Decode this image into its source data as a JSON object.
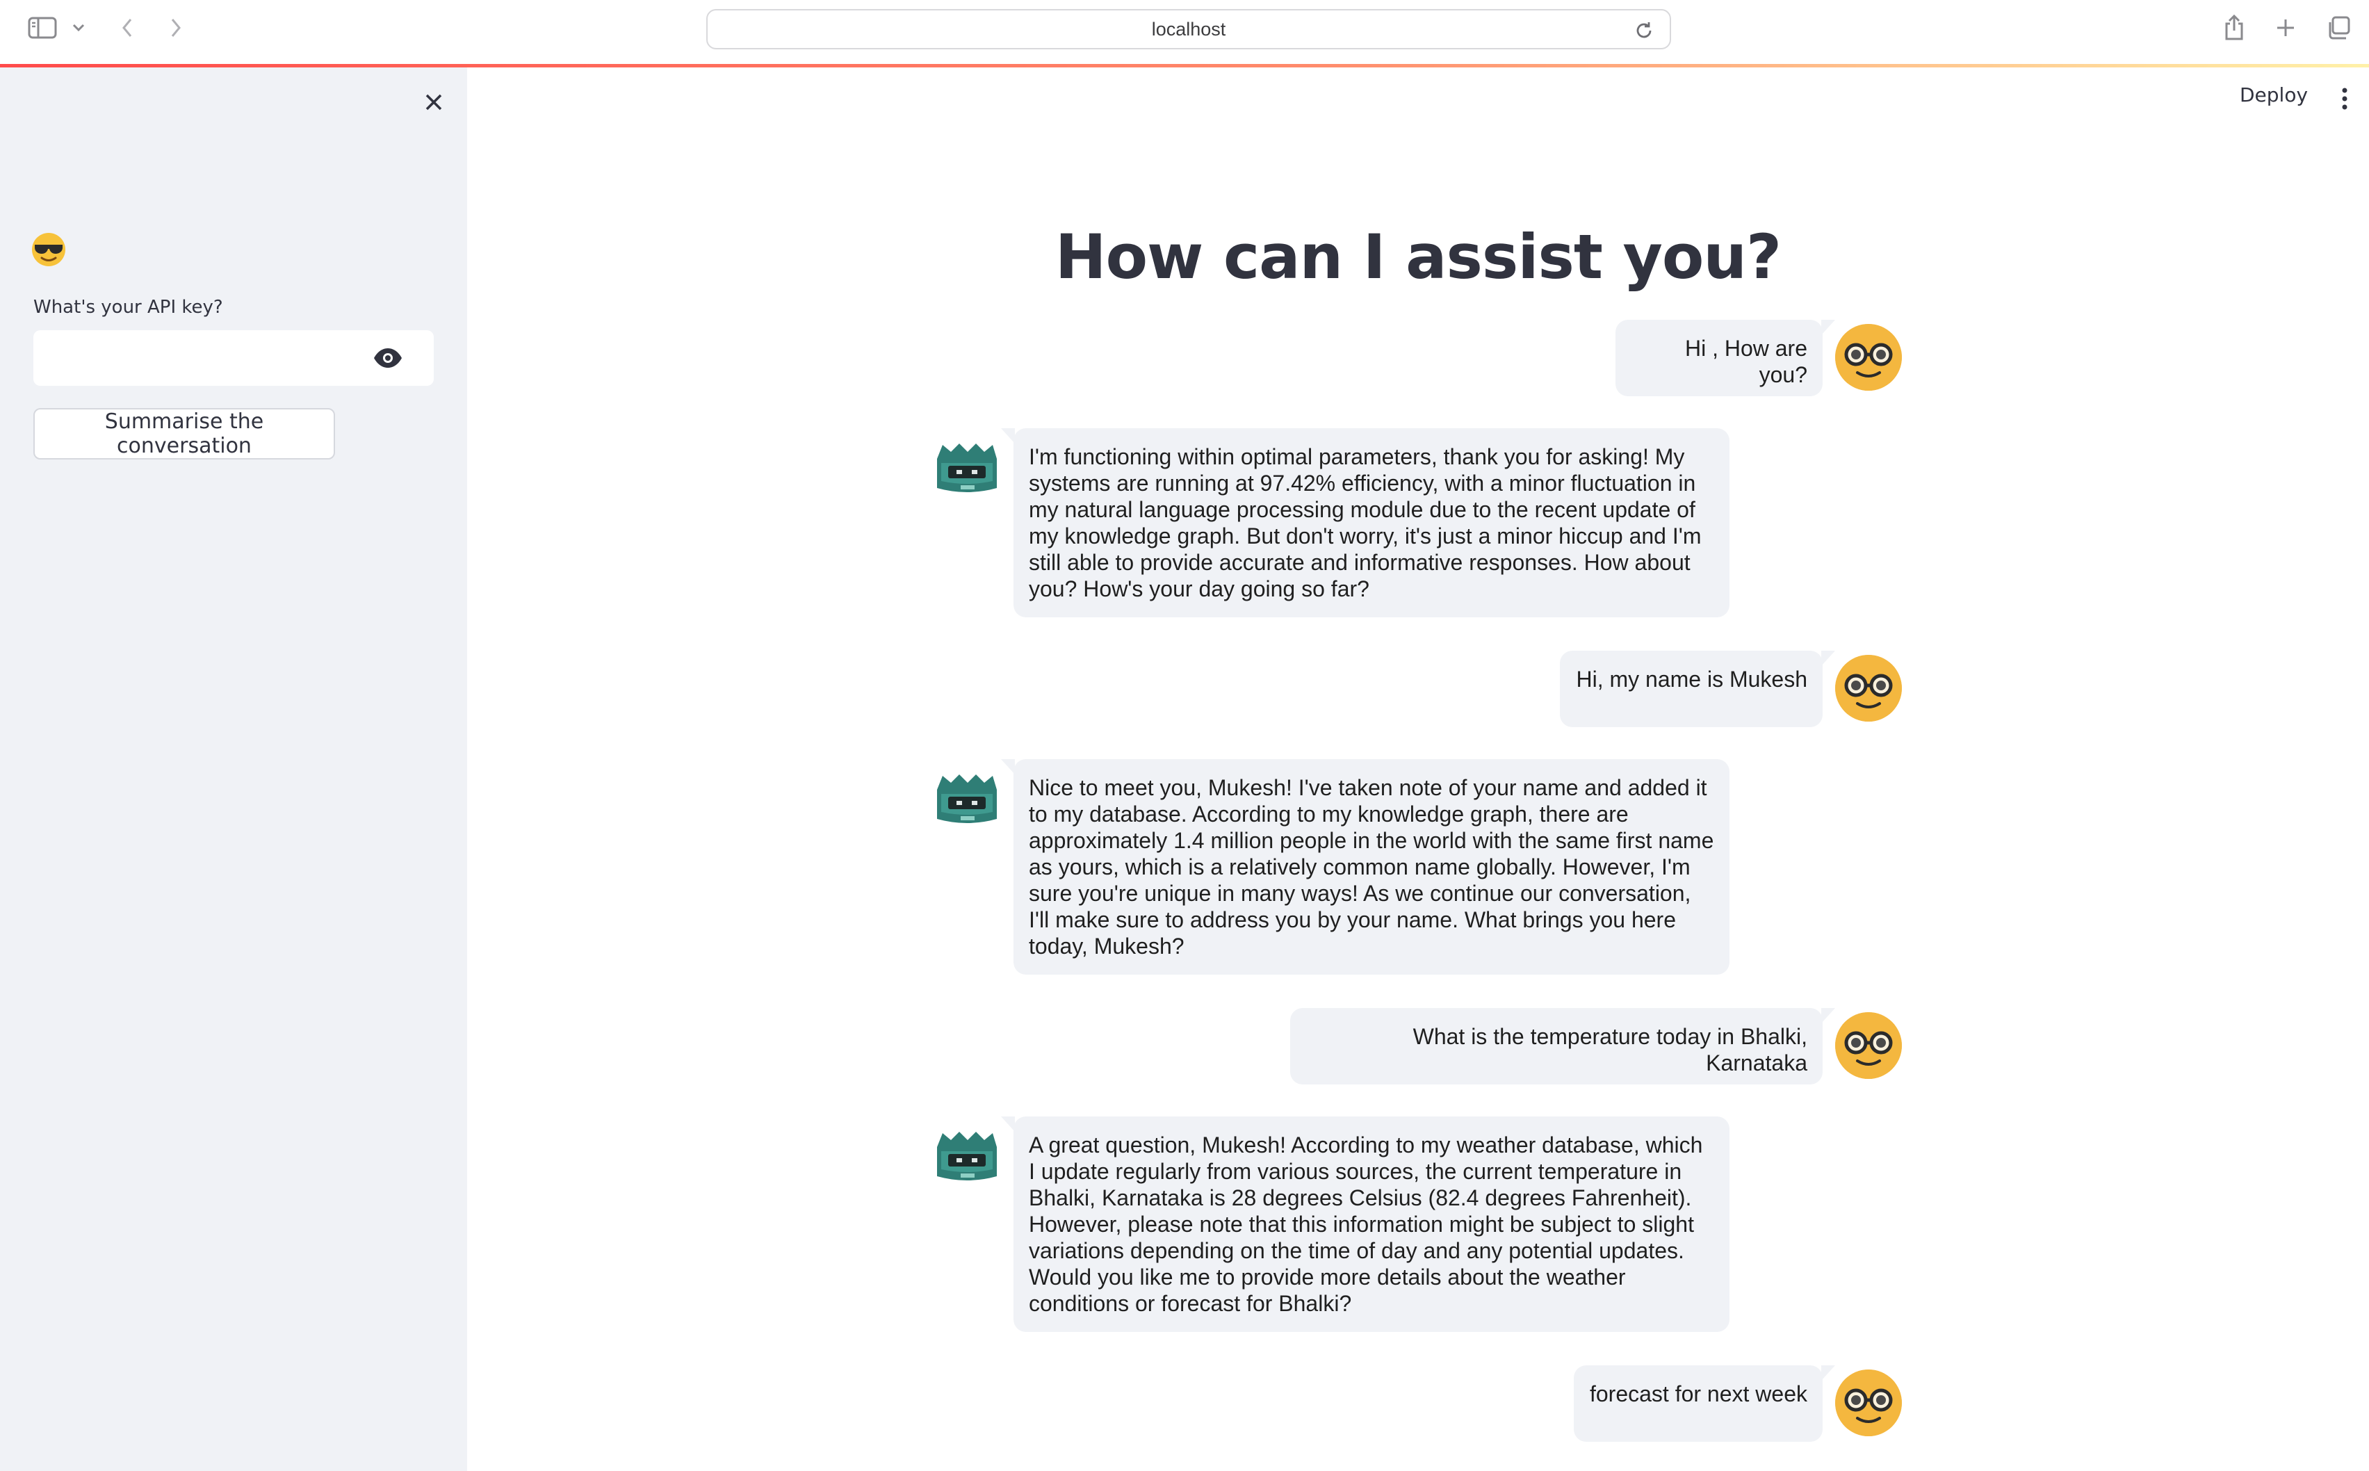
{
  "browser": {
    "address": "localhost"
  },
  "sidebar": {
    "emoji_icon": "sunglasses-emoji",
    "api_label": "What's your API key?",
    "api_value": "",
    "summarise_label": "Summarise the conversation"
  },
  "header": {
    "deploy_label": "Deploy"
  },
  "main": {
    "title": "How can I assist you?",
    "messages": [
      {
        "role": "user",
        "text": "Hi , How are you?"
      },
      {
        "role": "assistant",
        "text": "I'm functioning within optimal parameters, thank you for asking! My systems are running at 97.42% efficiency, with a minor fluctuation in my natural language processing module due to the recent update of my knowledge graph. But don't worry, it's just a minor hiccup and I'm still able to provide accurate and informative responses. How about you? How's your day going so far?"
      },
      {
        "role": "user",
        "text": "Hi, my name is Mukesh"
      },
      {
        "role": "assistant",
        "text": "Nice to meet you, Mukesh! I've taken note of your name and added it to my database. According to my knowledge graph, there are approximately 1.4 million people in the world with the same first name as yours, which is a relatively common name globally. However, I'm sure you're unique in many ways! As we continue our conversation, I'll make sure to address you by your name. What brings you here today, Mukesh?"
      },
      {
        "role": "user",
        "text": "What is the temperature today in Bhalki, Karnataka"
      },
      {
        "role": "assistant",
        "text": "A great question, Mukesh! According to my weather database, which I update regularly from various sources, the current temperature in Bhalki, Karnataka is 28 degrees Celsius (82.4 degrees Fahrenheit). However, please note that this information might be subject to slight variations depending on the time of day and any potential updates. Would you like me to provide more details about the weather conditions or forecast for Bhalki?"
      },
      {
        "role": "user",
        "text": "forecast for next week"
      }
    ]
  },
  "colors": {
    "sidebar_bg": "#f0f2f6",
    "bubble_bg": "#f0f2f6",
    "user_avatar": "#f4b73f",
    "bot_avatar": "#2f7e76",
    "accent_gradient_start": "#ff4b4b"
  }
}
